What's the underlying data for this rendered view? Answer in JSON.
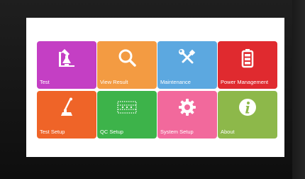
{
  "tiles": [
    {
      "label": "Test",
      "color": "#c43fc4",
      "icon": "flask-burner-icon"
    },
    {
      "label": "View Result",
      "color": "#f39b42",
      "icon": "magnifier-icon"
    },
    {
      "label": "Maintenance",
      "color": "#5ca8e0",
      "icon": "wrench-screwdriver-icon"
    },
    {
      "label": "Power Management",
      "color": "#e02a2f",
      "icon": "battery-icon"
    },
    {
      "label": "Test Setup",
      "color": "#ef6428",
      "icon": "pipette-rack-icon"
    },
    {
      "label": "QC Setup",
      "color": "#3db34a",
      "icon": "dotted-grid-icon"
    },
    {
      "label": "System Setup",
      "color": "#f2699c",
      "icon": "gear-icon"
    },
    {
      "label": "About",
      "color": "#8db84a",
      "icon": "info-icon"
    }
  ]
}
